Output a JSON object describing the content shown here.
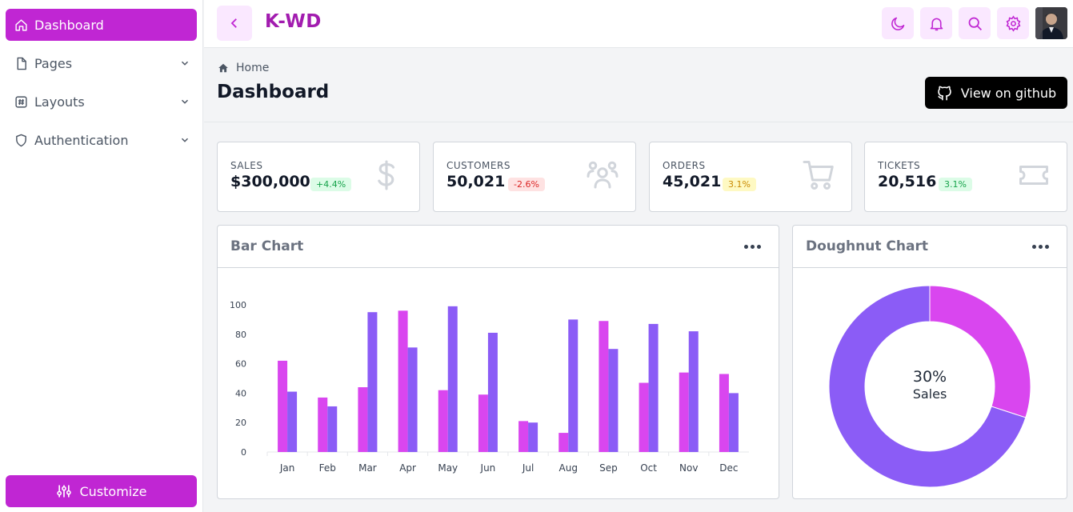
{
  "sidebar": {
    "items": [
      {
        "label": "Dashboard",
        "icon": "home-icon",
        "active": true
      },
      {
        "label": "Pages",
        "icon": "file-icon"
      },
      {
        "label": "Layouts",
        "icon": "hash-icon"
      },
      {
        "label": "Authentication",
        "icon": "shield-icon"
      }
    ],
    "customize_label": "Customize"
  },
  "header": {
    "brand": "K-WD",
    "icons": [
      "chevron-left-icon",
      "moon-icon",
      "bell-icon",
      "search-icon",
      "gear-icon",
      "avatar"
    ]
  },
  "page": {
    "breadcrumb": "Home",
    "title": "Dashboard",
    "github_label": "View on github"
  },
  "stats": [
    {
      "title": "SALES",
      "value": "$300,000",
      "badge": "+4.4%",
      "badge_tone": "green",
      "icon": "dollar-icon"
    },
    {
      "title": "CUSTOMERS",
      "value": "50,021",
      "badge": "-2.6%",
      "badge_tone": "red",
      "icon": "users-icon"
    },
    {
      "title": "ORDERS",
      "value": "45,021",
      "badge": "3.1%",
      "badge_tone": "yellow",
      "icon": "cart-icon"
    },
    {
      "title": "TICKETS",
      "value": "20,516",
      "badge": "3.1%",
      "badge_tone": "green",
      "icon": "ticket-icon"
    }
  ],
  "colors": {
    "accent": "#c026d3",
    "series_a": "#d946ef",
    "series_b": "#8b5cf6",
    "badge_green_bg": "#dcfce7",
    "badge_green_fg": "#16a34a",
    "badge_red_bg": "#fee2e2",
    "badge_red_fg": "#dc2626",
    "badge_yellow_bg": "#fef9c3",
    "badge_yellow_fg": "#ca8a04"
  },
  "bar_panel": {
    "title": "Bar Chart"
  },
  "doughnut_panel": {
    "title": "Doughnut Chart",
    "percent": "30%",
    "label": "Sales"
  },
  "chart_data": [
    {
      "type": "bar",
      "categories": [
        "Jan",
        "Feb",
        "Mar",
        "Apr",
        "May",
        "Jun",
        "Jul",
        "Aug",
        "Sep",
        "Oct",
        "Nov",
        "Dec"
      ],
      "series": [
        {
          "values": [
            62,
            37,
            44,
            96,
            42,
            39,
            21,
            13,
            89,
            47,
            54,
            53
          ]
        },
        {
          "values": [
            41,
            31,
            95,
            71,
            99,
            81,
            20,
            90,
            70,
            87,
            82,
            40
          ]
        }
      ],
      "ylim": [
        0,
        100
      ],
      "yticks": [
        0,
        20,
        40,
        60,
        80,
        100
      ],
      "grid": false,
      "legend": "none"
    },
    {
      "type": "pie",
      "variant": "doughnut",
      "slices": [
        {
          "value": 30,
          "color": "#d946ef"
        },
        {
          "value": 70,
          "color": "#8b5cf6"
        }
      ],
      "center_text": [
        "30%",
        "Sales"
      ]
    }
  ]
}
